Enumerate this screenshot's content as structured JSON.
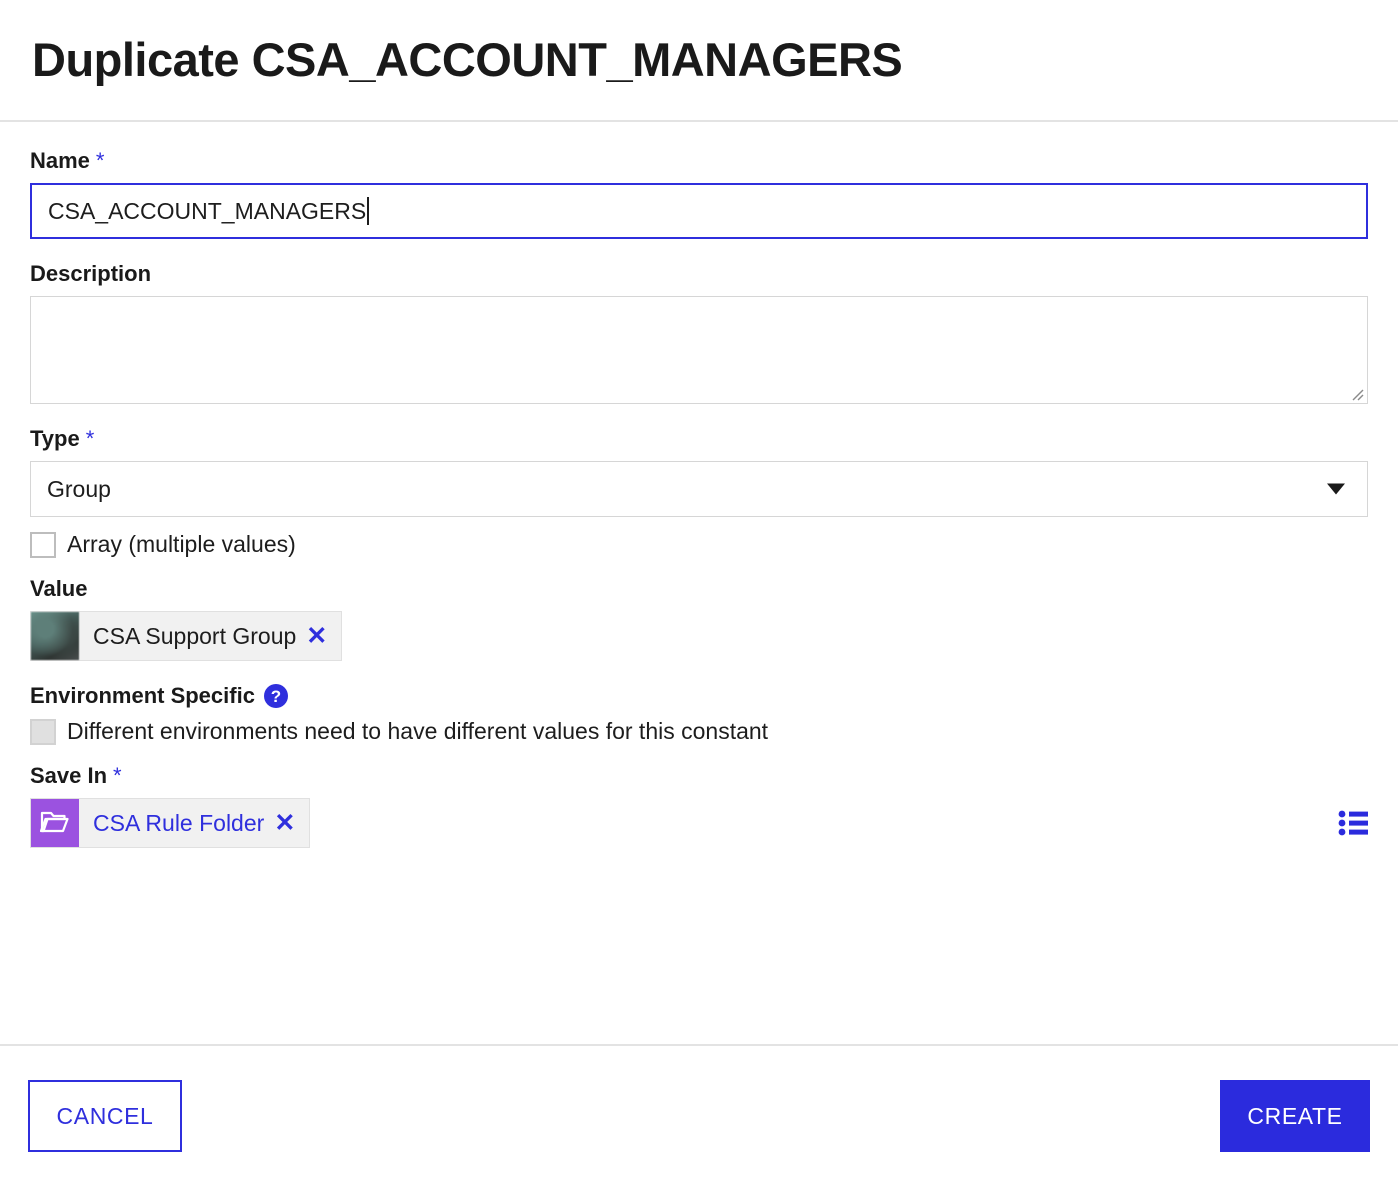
{
  "dialog": {
    "title": "Duplicate CSA_ACCOUNT_MANAGERS"
  },
  "fields": {
    "name": {
      "label": "Name",
      "required_marker": "*",
      "value": "CSA_ACCOUNT_MANAGERS",
      "placeholder": ""
    },
    "description": {
      "label": "Description",
      "value": "",
      "placeholder": ""
    },
    "type": {
      "label": "Type",
      "required_marker": "*",
      "selected": "Group",
      "options": [
        "Group"
      ],
      "dropdown_icon": "chevron-down-icon"
    },
    "array": {
      "label": "Array (multiple values)",
      "checked": false
    },
    "value": {
      "label": "Value",
      "chip": {
        "text": "CSA Support Group",
        "avatar_icon": "user-avatar-photo",
        "remove_icon": "✕"
      }
    },
    "environment_specific": {
      "label": "Environment Specific",
      "help_icon": "?",
      "checkbox_label": "Different environments need to have different values for this constant",
      "checked": false,
      "disabled": true
    },
    "save_in": {
      "label": "Save In",
      "required_marker": "*",
      "chip": {
        "text": "CSA Rule Folder",
        "folder_icon": "folder-open-icon",
        "remove_icon": "✕"
      },
      "browse_icon": "list-icon"
    }
  },
  "footer": {
    "cancel_label": "CANCEL",
    "create_label": "CREATE"
  },
  "colors": {
    "accent_blue": "#2F2FDD",
    "primary_button": "#2B2BDD",
    "folder_purple": "#9B52E0",
    "border_gray": "#D6D6D6",
    "divider_gray": "#E3E3E3",
    "chip_background": "#F1F1F1"
  }
}
